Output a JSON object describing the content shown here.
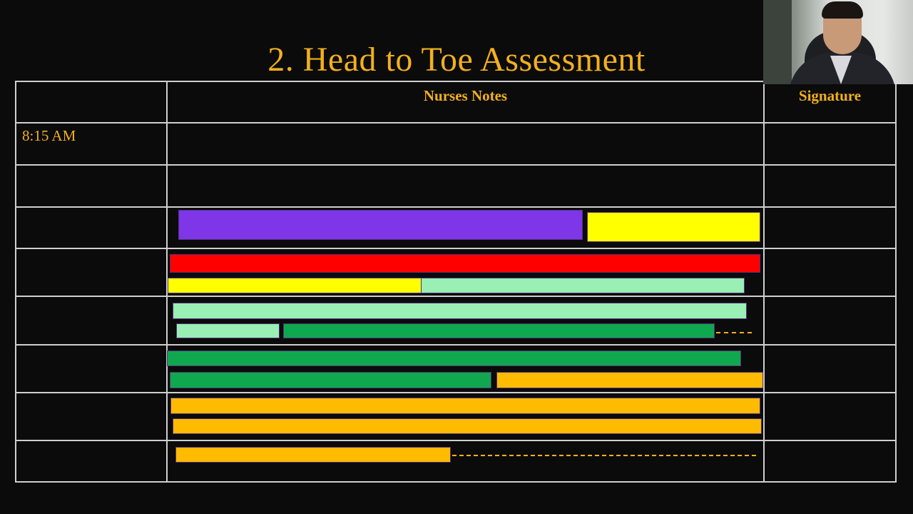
{
  "slide": {
    "title": "2. Head to Toe Assessment"
  },
  "table": {
    "headers": {
      "time": "",
      "notes": "Nurses Notes",
      "signature": "Signature"
    },
    "first_time": "8:15 AM"
  },
  "highlight_colors": {
    "purple": "#7e36e8",
    "yellow": "#ffff00",
    "red": "#ff0000",
    "light_green": "#99efb4",
    "green": "#0fa84e",
    "orange": "#ffbb00"
  },
  "webcam": {
    "icon": "presenter-video"
  }
}
